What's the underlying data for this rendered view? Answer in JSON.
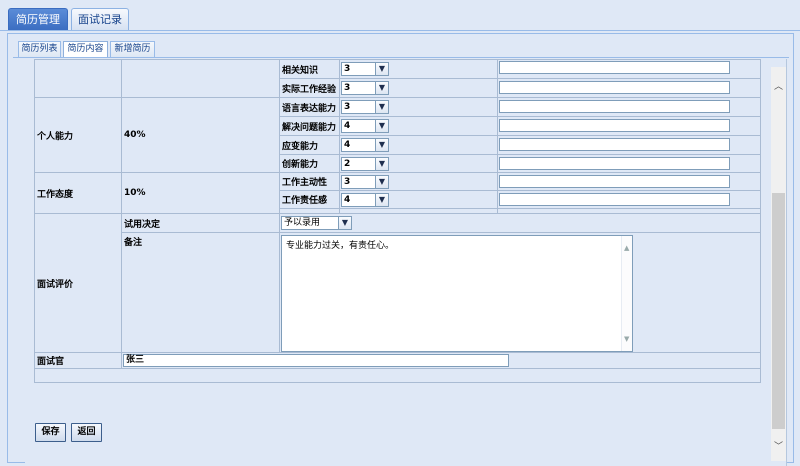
{
  "main_tabs": [
    {
      "label": "简历管理",
      "active": true
    },
    {
      "label": "面试记录",
      "active": false
    }
  ],
  "sub_tabs": [
    {
      "label": "简历列表",
      "active": false
    },
    {
      "label": "简历内容",
      "active": true
    },
    {
      "label": "新增简历",
      "active": false
    }
  ],
  "evaluation": {
    "partial_group": {
      "items": [
        {
          "label": "相关知识",
          "score": "3",
          "comment": ""
        },
        {
          "label": "实际工作经验",
          "score": "3",
          "comment": ""
        }
      ]
    },
    "personal_ability": {
      "label": "个人能力",
      "weight": "40%",
      "items": [
        {
          "label": "语言表达能力",
          "score": "3",
          "comment": ""
        },
        {
          "label": "解决问题能力",
          "score": "4",
          "comment": ""
        },
        {
          "label": "应变能力",
          "score": "4",
          "comment": ""
        },
        {
          "label": "创新能力",
          "score": "2",
          "comment": ""
        }
      ]
    },
    "work_attitude": {
      "label": "工作态度",
      "weight": "10%",
      "items": [
        {
          "label": "工作主动性",
          "score": "3",
          "comment": ""
        },
        {
          "label": "工作责任感",
          "score": "4",
          "comment": ""
        }
      ]
    }
  },
  "review": {
    "label": "面试评价",
    "decision_label": "试用决定",
    "decision_value": "予以录用",
    "remarks_label": "备注",
    "remarks_value": "专业能力过关，有责任心。"
  },
  "interviewer": {
    "label": "面试官",
    "value": "张三"
  },
  "buttons": {
    "save": "保存",
    "back": "返回"
  },
  "colors": {
    "background": "#dfe8f6",
    "active_tab": "#3a6cc0",
    "border": "#99bbe8"
  }
}
